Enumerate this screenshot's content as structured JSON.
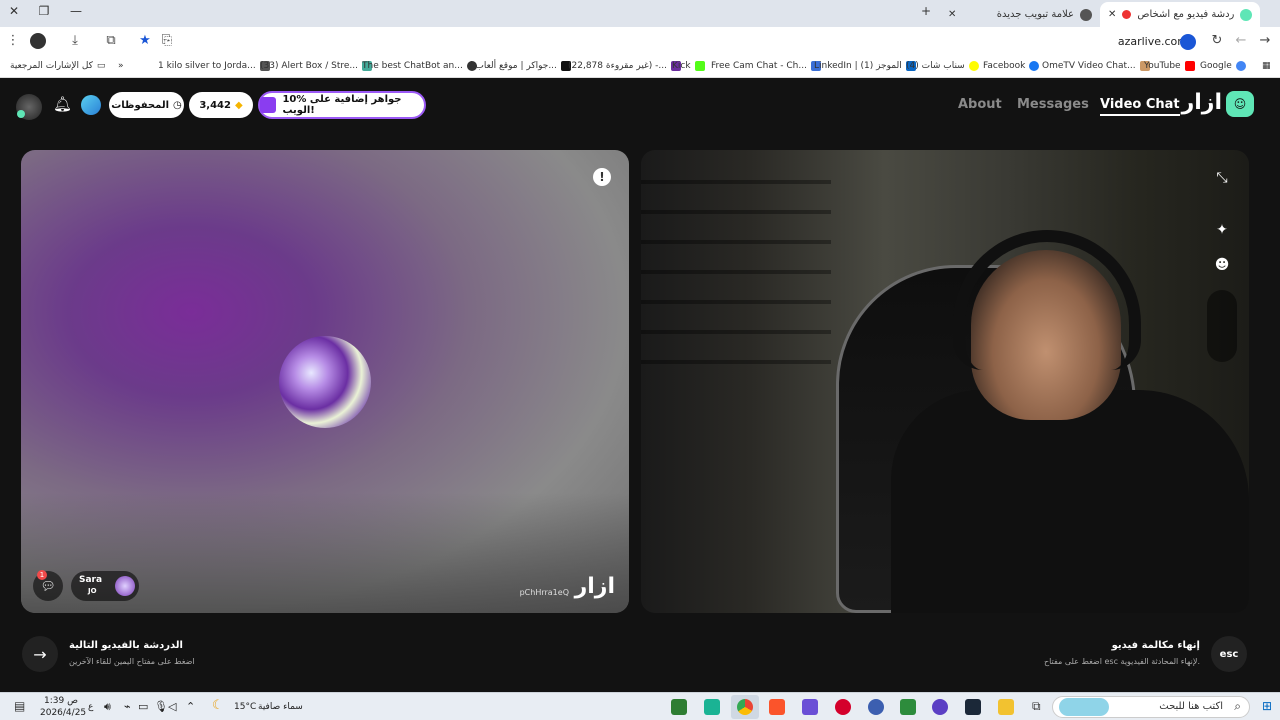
{
  "browser": {
    "tabs": [
      {
        "label": "أزار:دردشة فيديو مع أشخاص",
        "active": true
      },
      {
        "label": "علامة تبويب جديدة",
        "active": false
      }
    ],
    "url": "azarlive.com",
    "bookmarks": [
      "Google",
      "YouTube",
      "OmeTV Video Chat...",
      "Facebook",
      "(4) سناب شات",
      "LinkedIn | (1) الموجز",
      "Free Cam Chat - Ch...",
      "Kick",
      "(22,878 غير مقروءة) -...",
      "جواكر | موقع ألعاب ا...",
      "The best ChatBot an...",
      "(33) Alert Box / Stre...",
      "1 kilo silver to Jorda..."
    ],
    "bookmarks_folder": "كل الإشارات المرجعية"
  },
  "app": {
    "logo": "ازار",
    "nav": {
      "video_chat": "Video Chat",
      "messages": "Messages",
      "about": "About"
    },
    "promo": "10% جواهر إضافية على الويب!",
    "gems": "3,442",
    "saved": "المحفوظات"
  },
  "call": {
    "partner": {
      "name": "Sara",
      "country": "JO"
    },
    "unread_count": "1",
    "watermark": "ازار",
    "watermark_id": "pChHrra1eQ"
  },
  "controls": {
    "next": {
      "title": "الدردشة بالفيديو التالية",
      "subtitle": "اضغط على مفتاح اليمين للقاء الآخرين"
    },
    "end": {
      "title": "إنهاء مكالمة فيديو",
      "subtitle": "اضغط على مفتاح esc لإنهاء المحادثة الفيديوية.",
      "key": "esc"
    }
  },
  "taskbar": {
    "search_placeholder": "اكتب هنا للبحث",
    "weather_temp": "15°C",
    "weather_desc": "سماء صافية",
    "time": "1:39 ص",
    "date": "2026/4/25",
    "lang": "ع"
  },
  "colors": {
    "accent": "#5fe6b6",
    "promo_border": "#9b59f5"
  }
}
